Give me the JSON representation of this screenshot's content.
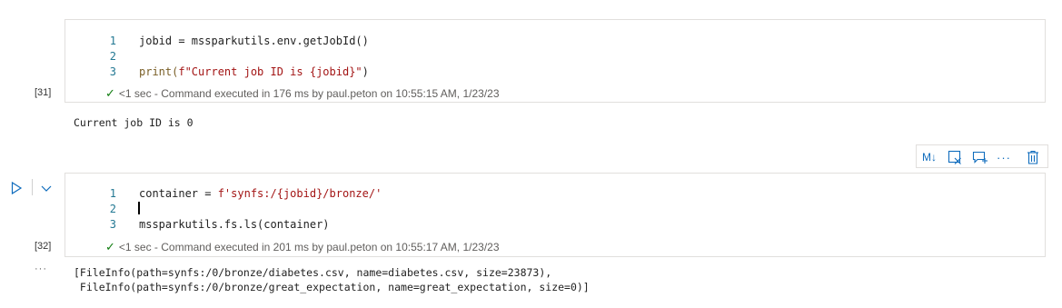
{
  "cell1": {
    "lines": [
      {
        "num": "1",
        "code": "jobid = mssparkutils.env.getJobId()"
      },
      {
        "num": "2",
        "code": ""
      },
      {
        "num": "3",
        "code_pre": "print(",
        "code_str": "f\"Current job ID is {jobid}\"",
        "code_post": ")"
      }
    ],
    "exec_count": "[31]",
    "status": "<1 sec - Command executed in 176 ms by paul.peton on 10:55:15 AM, 1/23/23",
    "output": "Current job ID is 0"
  },
  "toolbar": {
    "markdown_label": "M↓",
    "more_label": "···"
  },
  "cell2": {
    "lines": [
      {
        "num": "1",
        "code_pre": "container = ",
        "code_str": "f'synfs:/{jobid}/bronze/'"
      },
      {
        "num": "2",
        "code": ""
      },
      {
        "num": "3",
        "code": "mssparkutils.fs.ls(container)"
      }
    ],
    "exec_count": "[32]",
    "status": "<1 sec - Command executed in 201 ms by paul.peton on 10:55:17 AM, 1/23/23",
    "output_more": "···",
    "output": "[FileInfo(path=synfs:/0/bronze/diabetes.csv, name=diabetes.csv, size=23873),\n FileInfo(path=synfs:/0/bronze/great_expectation, name=great_expectation, size=0)]"
  },
  "colors": {
    "accent": "#0f6cbd",
    "success": "#107c10",
    "string": "#a31515",
    "line_number": "#237893"
  }
}
